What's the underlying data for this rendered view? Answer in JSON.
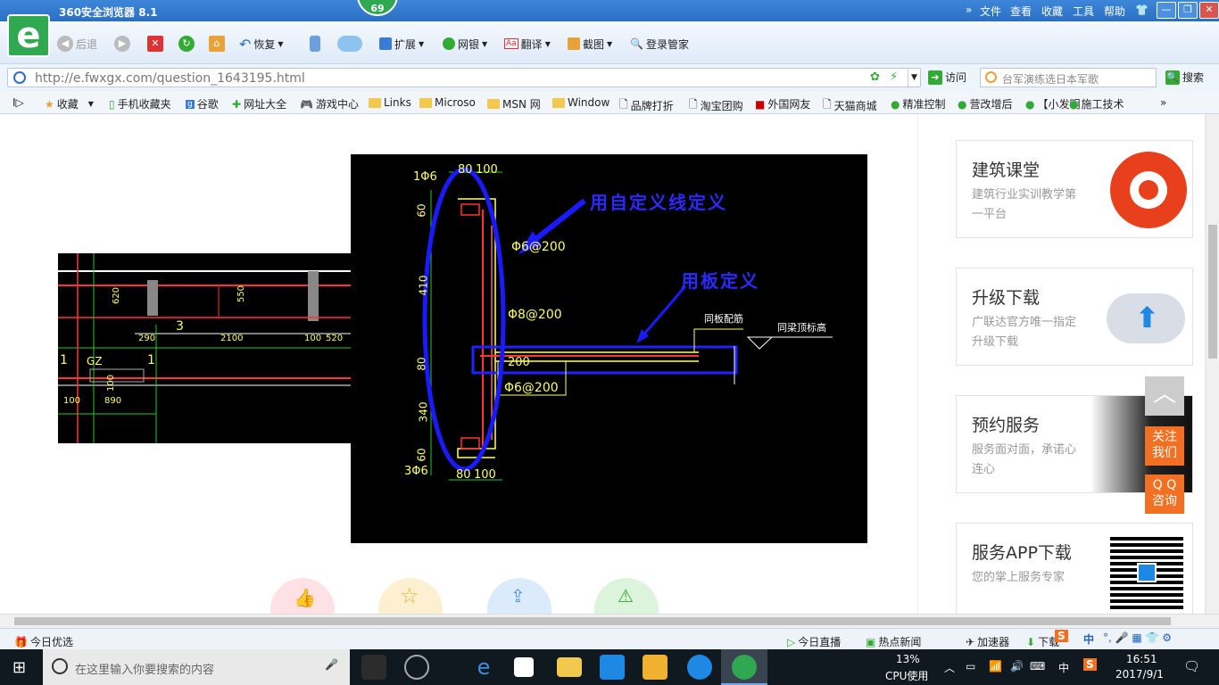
{
  "window": {
    "title": "360安全浏览器 8.1",
    "badge": "69",
    "menus": [
      "文件",
      "查看",
      "收藏",
      "工具",
      "帮助"
    ],
    "controls": [
      "—",
      "❐",
      "✕"
    ]
  },
  "toolbar": {
    "back": "后退",
    "restore": "恢复",
    "extend": "扩展",
    "bank": "网银",
    "translate": "翻译",
    "screenshot": "截图",
    "login": "登录管家"
  },
  "address": {
    "url": "http://e.fwxgx.com/question_1643195.html",
    "go": "访问",
    "search_placeholder": "台军演练选日本军歌",
    "search_btn": "搜索"
  },
  "favorites": [
    "收藏",
    "手机收藏夹",
    "谷歌",
    "网址大全",
    "游戏中心",
    "Links",
    "Microso",
    "MSN 网",
    "Window",
    "品牌打折",
    "淘宝团购",
    "外国网友",
    "天猫商城",
    "精准控制",
    "营改增后",
    "【小发明",
    "施工技术"
  ],
  "cad_left": {
    "labels": [
      "620",
      "550",
      "290",
      "3",
      "2100",
      "100",
      "520",
      "1",
      "GZ",
      "1",
      "100",
      "890",
      "100"
    ]
  },
  "cad_main": {
    "labels": [
      "1Φ6",
      "80",
      "100",
      "60",
      "410",
      "80",
      "340",
      "60",
      "3Φ6",
      "Φ6@200",
      "Φ8@200",
      "200",
      "Φ6@200",
      "同板配筋",
      "同梁顶标高",
      "80",
      "100"
    ],
    "annotation1": "用自定义线定义",
    "annotation2": "用板定义"
  },
  "sidebar": [
    {
      "title": "建筑课堂",
      "desc": "建筑行业实训教学第一平台"
    },
    {
      "title": "升级下载",
      "desc": "广联达官方唯一指定升级下载"
    },
    {
      "title": "预约服务",
      "desc": "服务面对面，承诺心连心"
    },
    {
      "title": "服务APP下载",
      "desc": "您的掌上服务专家"
    }
  ],
  "float": {
    "follow": "关注我们",
    "qq": "Q Q 咨询"
  },
  "status": {
    "today": "今日优选",
    "live": "今日直播",
    "hot": "热点新闻",
    "speed": "加速器",
    "download": "下载"
  },
  "taskbar": {
    "search": "在这里输入你要搜索的内容",
    "cpu_pct": "13%",
    "cpu_label": "CPU使用",
    "ime": "中",
    "time": "16:51",
    "date": "2017/9/1"
  },
  "colors": {
    "accent": "#2a6fc4",
    "green": "#2fa84f",
    "orange": "#f36f21"
  }
}
